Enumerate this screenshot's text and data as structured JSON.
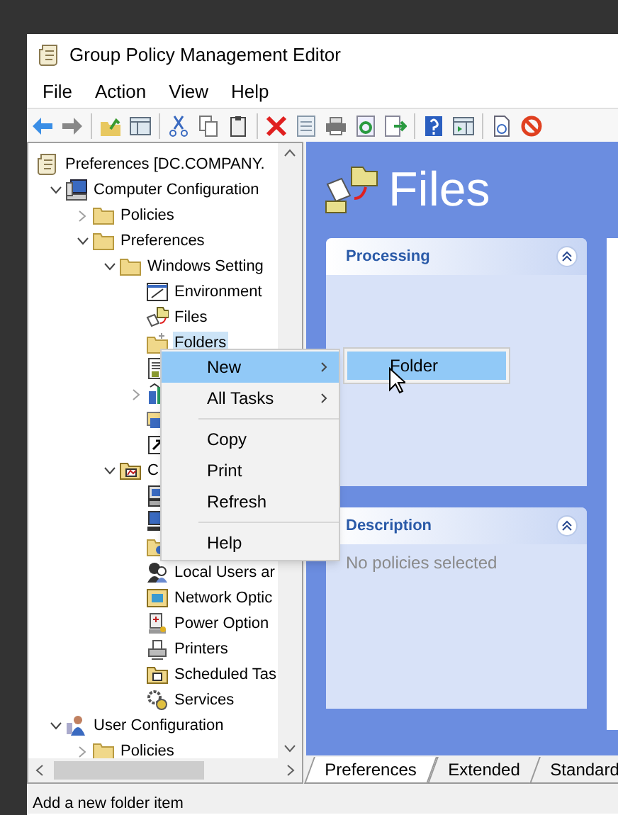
{
  "window": {
    "title": "Group Policy Management Editor"
  },
  "menu_bar": [
    "File",
    "Action",
    "View",
    "Help"
  ],
  "tree": [
    {
      "label": "Preferences [DC.COMPANY.",
      "selected": false,
      "children": [
        {
          "label": "Computer Configuration",
          "expanded": true,
          "selected": false,
          "children": [
            {
              "label": "Policies",
              "expanded": false,
              "selected": false
            },
            {
              "label": "Preferences",
              "expanded": true,
              "selected": false,
              "children": [
                {
                  "label": "Windows Setting",
                  "expanded": true,
                  "selected": false,
                  "children": [
                    {
                      "label": "Environment",
                      "selected": false
                    },
                    {
                      "label": "Files",
                      "selected": false
                    },
                    {
                      "label": "Folders",
                      "selected": true
                    },
                    {
                      "selected": false
                    },
                    {
                      "expanded": false,
                      "selected": false
                    },
                    {
                      "selected": false
                    },
                    {
                      "selected": false
                    }
                  ]
                },
                {
                  "label": "C",
                  "expanded": true,
                  "selected": false,
                  "children": [
                    {
                      "selected": false
                    },
                    {
                      "selected": false
                    },
                    {
                      "selected": false
                    },
                    {
                      "label": "Local Users ar",
                      "selected": false
                    },
                    {
                      "label": "Network Optic",
                      "selected": false
                    },
                    {
                      "label": "Power Option",
                      "selected": false
                    },
                    {
                      "label": "Printers",
                      "selected": false
                    },
                    {
                      "label": "Scheduled Tas",
                      "selected": false
                    },
                    {
                      "label": "Services",
                      "selected": false
                    }
                  ]
                }
              ]
            }
          ]
        },
        {
          "label": "User Configuration",
          "expanded": true,
          "selected": false,
          "children": [
            {
              "label": "Policies",
              "expanded": false,
              "selected": false
            }
          ]
        }
      ]
    }
  ],
  "context_menu": [
    {
      "kind": "item",
      "label": "New",
      "submenu": true,
      "selected": true
    },
    {
      "kind": "item",
      "label": "All Tasks",
      "submenu": true,
      "selected": false
    },
    {
      "kind": "separator"
    },
    {
      "kind": "item",
      "label": "Copy",
      "submenu": false,
      "selected": false
    },
    {
      "kind": "item",
      "label": "Print",
      "submenu": false,
      "selected": false
    },
    {
      "kind": "item",
      "label": "Refresh",
      "submenu": false,
      "selected": false
    },
    {
      "kind": "separator"
    },
    {
      "kind": "item",
      "label": "Help",
      "submenu": false,
      "selected": false
    }
  ],
  "submenu": [
    {
      "label": "Folder",
      "selected": true
    }
  ],
  "content": {
    "title": "Files",
    "panels": [
      {
        "title": "Processing"
      },
      {
        "title": "Description",
        "text": "No policies selected"
      }
    ]
  },
  "tabs": [
    {
      "label": "Preferences",
      "selected": true
    },
    {
      "label": "Extended",
      "selected": false
    },
    {
      "label": "Standard",
      "selected": false
    }
  ],
  "status_bar": "Add a new folder item"
}
